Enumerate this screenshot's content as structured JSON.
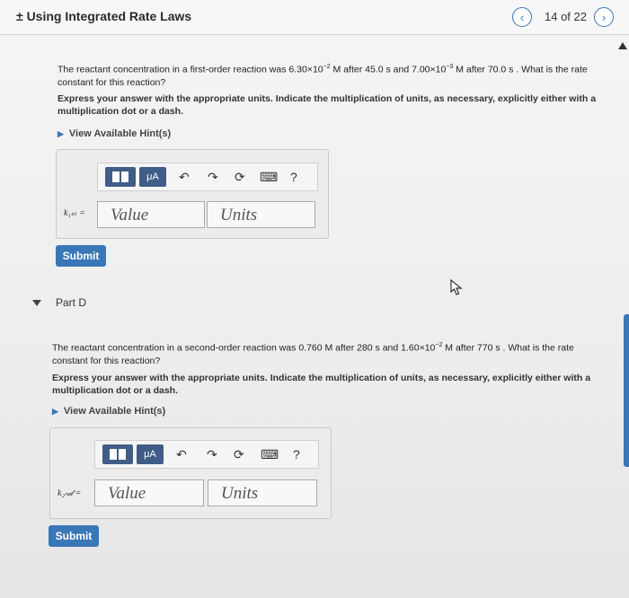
{
  "header": {
    "title": "± Using Integrated Rate Laws",
    "prev_icon": "chevron-left-icon",
    "next_icon": "chevron-right-icon",
    "counter": "14 of 22"
  },
  "partC": {
    "question_pre": "The reactant concentration in a first-order reaction was 6.30×10",
    "exp1": "−2",
    "q_mid1": " M after 45.0 s and 7.00×10",
    "exp2": "−3",
    "q_mid2": " M after 70.0 s . What is the rate",
    "question_line2": "constant for this reaction?",
    "instructions": "Express your answer with the appropriate units. Indicate the multiplication of units, as necessary, explicitly either with a multiplication dot or a dash.",
    "hint": "View Available Hint(s)",
    "variable": "k₁ₛₜ =",
    "value_placeholder": "Value",
    "units_placeholder": "Units",
    "submit": "Submit"
  },
  "toolbar": {
    "mu_label": "μA",
    "help": "?",
    "icons": [
      "templates-icon",
      "units-icon",
      "undo-icon",
      "redo-icon",
      "reset-icon",
      "keyboard-icon",
      "help-icon"
    ]
  },
  "partD": {
    "title": "Part D",
    "question_pre": "The reactant concentration in a second-order reaction was 0.760 M after 280 s and 1.60×10",
    "exp1": "−2",
    "q_mid1": " M after 770 s . What is the rate",
    "question_line2": "constant for this reaction?",
    "instructions": "Express your answer with the appropriate units. Indicate the multiplication of units, as necessary, explicitly either with a multiplication dot or a dash.",
    "hint": "View Available Hint(s)",
    "variable": "k₂ₙ𝒹 =",
    "value_placeholder": "Value",
    "units_placeholder": "Units",
    "submit": "Submit"
  },
  "colors": {
    "accent": "#3a77b7",
    "toolbar_dark": "#3f5d86"
  }
}
